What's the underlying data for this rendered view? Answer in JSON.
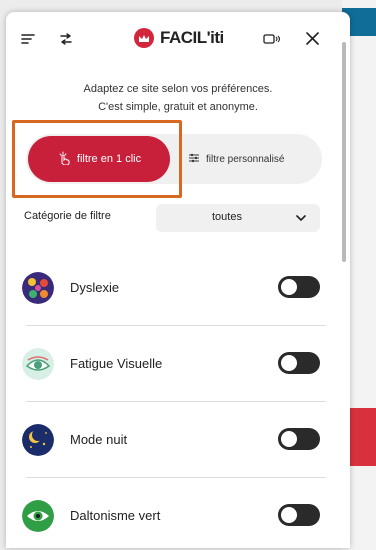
{
  "header": {
    "brand": "FACIL'iti"
  },
  "intro": {
    "line1": "Adaptez ce site selon vos préférences.",
    "line2": "C'est simple, gratuit et anonyme."
  },
  "filter_modes": {
    "one_click": "filtre en 1 clic",
    "custom": "filtre personnalisé"
  },
  "category": {
    "label": "Catégorie de filtre",
    "value": "toutes"
  },
  "filters": [
    {
      "label": "Dyslexie",
      "icon": "dyslexia-icon",
      "enabled": false
    },
    {
      "label": "Fatigue Visuelle",
      "icon": "eye-fatigue-icon",
      "enabled": false
    },
    {
      "label": "Mode nuit",
      "icon": "night-mode-icon",
      "enabled": false
    },
    {
      "label": "Daltonisme vert",
      "icon": "green-color-blind-icon",
      "enabled": false
    }
  ],
  "colors": {
    "brand_red": "#c8203a",
    "highlight_orange": "#d8681f"
  }
}
